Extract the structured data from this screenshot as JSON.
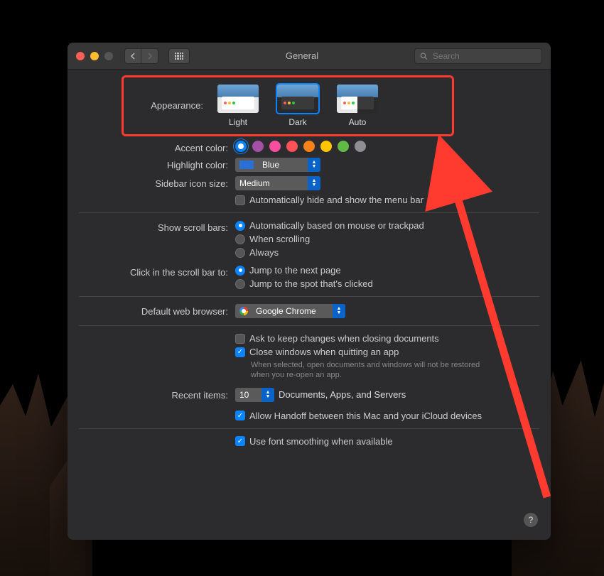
{
  "window": {
    "title": "General"
  },
  "search": {
    "placeholder": "Search"
  },
  "appearance": {
    "label": "Appearance:",
    "options": [
      {
        "id": "light",
        "label": "Light"
      },
      {
        "id": "dark",
        "label": "Dark"
      },
      {
        "id": "auto",
        "label": "Auto"
      }
    ],
    "selected": "dark"
  },
  "accent": {
    "label": "Accent color:",
    "colors": [
      "#0a84ff",
      "#a550a7",
      "#f74f9e",
      "#ff5257",
      "#f7821b",
      "#ffc600",
      "#62ba46",
      "#8e8e93"
    ],
    "selected_index": 0
  },
  "highlight": {
    "label": "Highlight color:",
    "value": "Blue"
  },
  "sidebar_size": {
    "label": "Sidebar icon size:",
    "value": "Medium"
  },
  "menubar_autohide": {
    "label": "Automatically hide and show the menu bar",
    "checked": false
  },
  "scrollbars": {
    "label": "Show scroll bars:",
    "options": [
      "Automatically based on mouse or trackpad",
      "When scrolling",
      "Always"
    ],
    "selected_index": 0
  },
  "scrollclick": {
    "label": "Click in the scroll bar to:",
    "options": [
      "Jump to the next page",
      "Jump to the spot that's clicked"
    ],
    "selected_index": 0
  },
  "browser": {
    "label": "Default web browser:",
    "value": "Google Chrome"
  },
  "ask_keep": {
    "label": "Ask to keep changes when closing documents",
    "checked": false
  },
  "close_windows": {
    "label": "Close windows when quitting an app",
    "checked": true,
    "note": "When selected, open documents and windows will not be restored when you re-open an app."
  },
  "recent": {
    "label": "Recent items:",
    "value": "10",
    "suffix": "Documents, Apps, and Servers"
  },
  "handoff": {
    "label": "Allow Handoff between this Mac and your iCloud devices",
    "checked": true
  },
  "font_smoothing": {
    "label": "Use font smoothing when available",
    "checked": true
  },
  "help_tooltip": "?"
}
